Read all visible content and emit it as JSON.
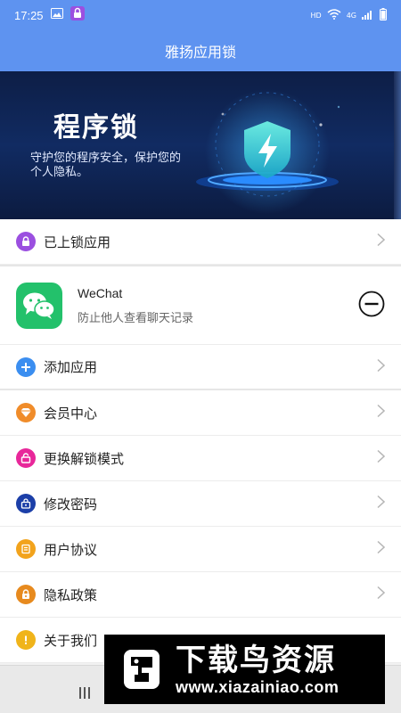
{
  "status_bar": {
    "time": "17:25",
    "network_label": "HD",
    "signal_label": "4G"
  },
  "header": {
    "title": "雅扬应用锁"
  },
  "banner": {
    "title": "程序锁",
    "subtitle": "守护您的程序安全，保护您的个人隐私。"
  },
  "locked_section": {
    "label": "已上锁应用",
    "apps": [
      {
        "name": "WeChat",
        "description": "防止他人查看聊天记录"
      }
    ],
    "add_label": "添加应用"
  },
  "menu": {
    "items": [
      {
        "label": "会员中心",
        "icon": "diamond-icon",
        "color": "#f08c2a"
      },
      {
        "label": "更换解锁模式",
        "icon": "unlock-icon",
        "color": "#e8279a"
      },
      {
        "label": "修改密码",
        "icon": "password-icon",
        "color": "#1c3fa8"
      },
      {
        "label": "用户协议",
        "icon": "agreement-icon",
        "color": "#f2a31c"
      },
      {
        "label": "隐私政策",
        "icon": "privacy-icon",
        "color": "#e78a1e"
      },
      {
        "label": "关于我们",
        "icon": "info-icon",
        "color": "#f0b41a"
      }
    ]
  },
  "colors": {
    "header": "#5e93f0",
    "locked_icon": "#9b4fe0",
    "add_icon": "#3b8ef0",
    "wechat": "#23c16b"
  },
  "watermark": {
    "title": "下载鸟资源",
    "url": "www.xiazainiao.com"
  }
}
